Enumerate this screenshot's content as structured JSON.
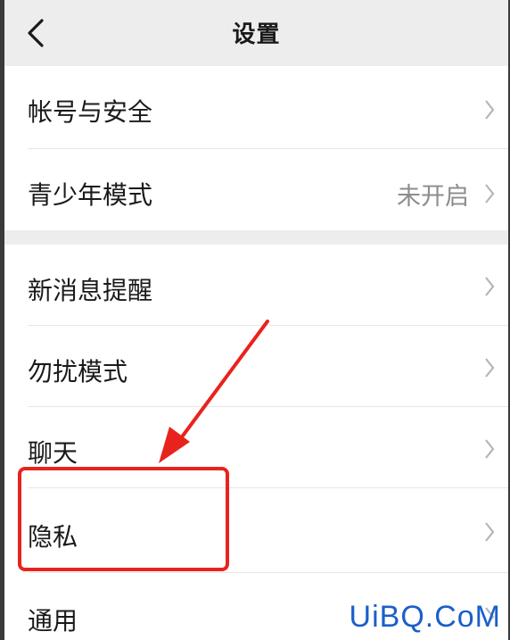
{
  "header": {
    "title": "设置"
  },
  "rows": [
    {
      "label": "帐号与安全",
      "value": ""
    },
    {
      "label": "青少年模式",
      "value": "未开启"
    },
    {
      "label": "新消息提醒",
      "value": ""
    },
    {
      "label": "勿扰模式",
      "value": ""
    },
    {
      "label": "聊天",
      "value": ""
    },
    {
      "label": "隐私",
      "value": ""
    },
    {
      "label": "通用",
      "value": ""
    }
  ],
  "annotation": {
    "color": "#e8231e",
    "highlighted": "隐私"
  },
  "watermark": "UiBQ.CoM",
  "colors": {
    "header_bg": "#ededed",
    "value_text": "#8c8c8c",
    "chevron": "#b5b5b5",
    "watermark": "#1b5fc8"
  }
}
